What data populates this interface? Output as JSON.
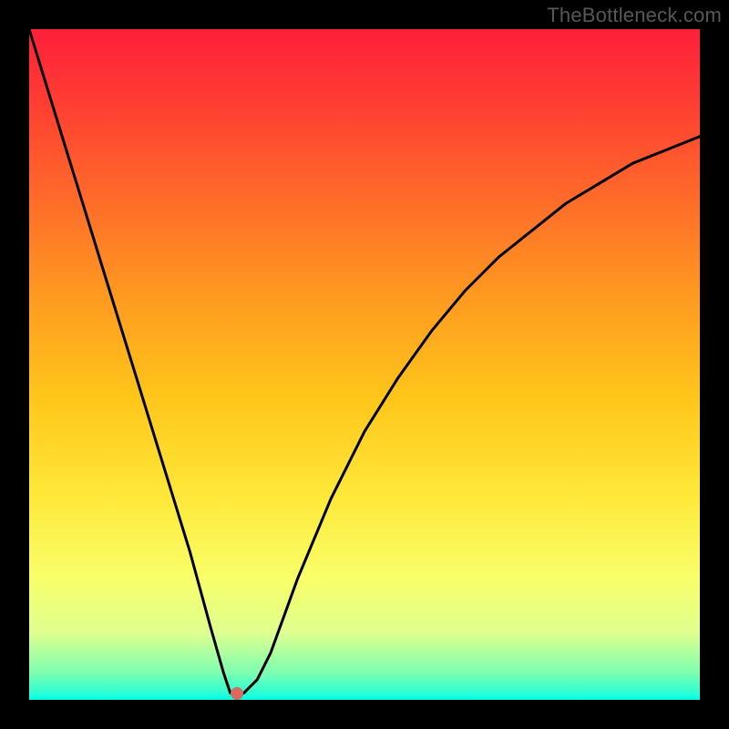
{
  "watermark": "TheBottleneck.com",
  "chart_data": {
    "type": "line",
    "title": "",
    "xlabel": "",
    "ylabel": "",
    "xlim": [
      0,
      100
    ],
    "ylim": [
      0,
      100
    ],
    "grid": false,
    "series": [
      {
        "name": "curve",
        "x": [
          0,
          4,
          8,
          12,
          16,
          20,
          24,
          27,
          29,
          30,
          31,
          32,
          34,
          36,
          40,
          45,
          50,
          55,
          60,
          65,
          70,
          75,
          80,
          85,
          90,
          95,
          100
        ],
        "values": [
          100,
          87,
          74,
          61,
          48,
          35,
          22,
          11,
          4,
          1,
          1,
          1,
          3,
          7,
          18,
          30,
          40,
          48,
          55,
          61,
          66,
          70,
          74,
          77,
          80,
          82,
          84
        ]
      }
    ],
    "marker": {
      "x": 31,
      "y": 1
    },
    "background_gradient": [
      {
        "pos": 0,
        "color": "#ff1f3a"
      },
      {
        "pos": 25,
        "color": "#ff6a2a"
      },
      {
        "pos": 55,
        "color": "#ffc61a"
      },
      {
        "pos": 82,
        "color": "#f8ff6a"
      },
      {
        "pos": 96,
        "color": "#7cffb0"
      },
      {
        "pos": 100,
        "color": "#00ffe6"
      }
    ]
  }
}
